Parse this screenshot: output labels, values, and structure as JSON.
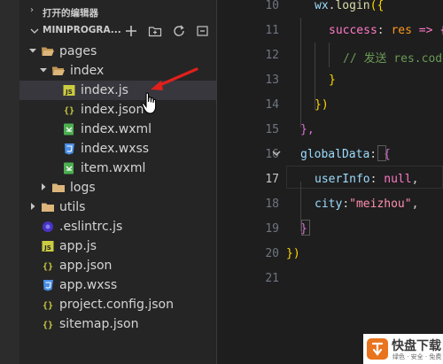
{
  "explorer": {
    "open_editors_label": "打开的编辑器",
    "project_label": "MINIPROGRA..."
  },
  "tree": [
    {
      "name": "pages",
      "type": "folder",
      "state": "open",
      "icon": "folder-open-icon"
    },
    {
      "name": "index",
      "type": "folder",
      "state": "open",
      "icon": "folder-open-icon"
    },
    {
      "name": "index.js",
      "type": "file",
      "icon": "js-file-icon",
      "selected": true
    },
    {
      "name": "index.json",
      "type": "file",
      "icon": "json-file-icon"
    },
    {
      "name": "index.wxml",
      "type": "file",
      "icon": "wxml-file-icon"
    },
    {
      "name": "index.wxss",
      "type": "file",
      "icon": "wxss-file-icon"
    },
    {
      "name": "item.wxml",
      "type": "file",
      "icon": "wxml-file-icon"
    },
    {
      "name": "logs",
      "type": "folder",
      "state": "closed",
      "icon": "folder-icon"
    },
    {
      "name": "utils",
      "type": "folder",
      "state": "closed",
      "icon": "folder-icon"
    },
    {
      "name": ".eslintrc.js",
      "type": "file",
      "icon": "eslint-file-icon"
    },
    {
      "name": "app.js",
      "type": "file",
      "icon": "js-file-icon"
    },
    {
      "name": "app.json",
      "type": "file",
      "icon": "json-file-icon"
    },
    {
      "name": "app.wxss",
      "type": "file",
      "icon": "wxss-file-icon"
    },
    {
      "name": "project.config.json",
      "type": "file",
      "icon": "json-file-icon"
    },
    {
      "name": "sitemap.json",
      "type": "file",
      "icon": "json-file-icon"
    }
  ],
  "editor": {
    "active_line": "17",
    "lines": [
      {
        "n": "10",
        "tokens": [
          {
            "t": "wx",
            "c": "var"
          },
          {
            "t": ".",
            "c": "plain"
          },
          {
            "t": "login",
            "c": "fn"
          },
          {
            "t": "({",
            "c": "brace"
          }
        ]
      },
      {
        "n": "11",
        "tokens": [
          {
            "t": "success",
            "c": "key"
          },
          {
            "t": ": ",
            "c": "plain"
          },
          {
            "t": "res",
            "c": "param"
          },
          {
            "t": " => {",
            "c": "key"
          }
        ]
      },
      {
        "n": "12",
        "tokens": [
          {
            "t": "// 发送 res.code",
            "c": "comment"
          }
        ]
      },
      {
        "n": "13",
        "tokens": [
          {
            "t": "}",
            "c": "brace"
          }
        ]
      },
      {
        "n": "14",
        "tokens": [
          {
            "t": "})",
            "c": "brace"
          }
        ]
      },
      {
        "n": "15",
        "tokens": [
          {
            "t": "},",
            "c": "brace2"
          }
        ]
      },
      {
        "n": "16",
        "tokens": [
          {
            "t": "globalData",
            "c": "var"
          },
          {
            "t": ": ",
            "c": "plain"
          },
          {
            "t": "{",
            "c": "brace2"
          }
        ]
      },
      {
        "n": "17",
        "tokens": [
          {
            "t": "userInfo",
            "c": "var"
          },
          {
            "t": ": ",
            "c": "plain"
          },
          {
            "t": "null",
            "c": "null"
          },
          {
            "t": ",",
            "c": "plain"
          }
        ]
      },
      {
        "n": "18",
        "tokens": [
          {
            "t": "city",
            "c": "var"
          },
          {
            "t": ":",
            "c": "plain"
          },
          {
            "t": "\"meizhou\"",
            "c": "string"
          },
          {
            "t": ",",
            "c": "plain"
          }
        ]
      },
      {
        "n": "19",
        "tokens": [
          {
            "t": "}",
            "c": "brace2"
          }
        ]
      },
      {
        "n": "20",
        "tokens": [
          {
            "t": "})",
            "c": "brace"
          }
        ]
      },
      {
        "n": "21",
        "tokens": []
      }
    ]
  },
  "watermark": {
    "brand": "快盘下载",
    "tagline": "绿色 · 安全 · 免费"
  },
  "colors": {
    "var": "#9cdcfe",
    "fn": "#dcdcaa",
    "key": "#ff79c6",
    "param": "#fd971f",
    "comment": "#6a9955",
    "brace": "#ffd700",
    "brace2": "#da70d6",
    "null": "#ff79c6",
    "string": "#ff8fb0",
    "plain": "#d4d4d4"
  }
}
